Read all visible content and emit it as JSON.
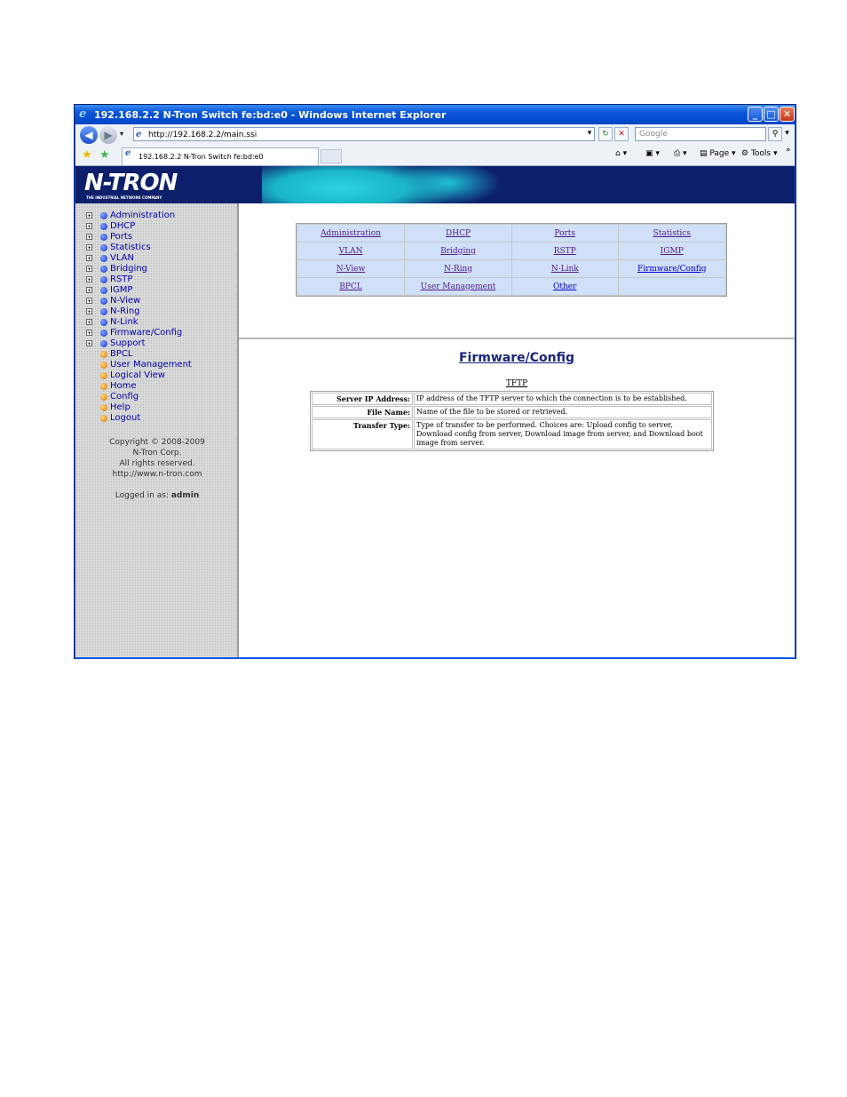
{
  "window": {
    "title": "192.168.2.2 N-Tron Switch fe:bd:e0 - Windows Internet Explorer",
    "minimize": "_",
    "maximize": "□",
    "close": "✕"
  },
  "addressbar": {
    "url": "http://192.168.2.2/main.ssi",
    "search_placeholder": "Google"
  },
  "tabs": [
    {
      "label": "192.168.2.2 N-Tron Switch fe:bd:e0"
    }
  ],
  "toolbar": {
    "page_label": "Page",
    "tools_label": "Tools"
  },
  "banner": {
    "logo": "N-TRON",
    "tagline": "THE INDUSTRIAL NETWORK COMPANY"
  },
  "sidebar": {
    "items": [
      {
        "label": "Administration",
        "expandable": true,
        "color": "blue"
      },
      {
        "label": "DHCP",
        "expandable": true,
        "color": "blue"
      },
      {
        "label": "Ports",
        "expandable": true,
        "color": "blue"
      },
      {
        "label": "Statistics",
        "expandable": true,
        "color": "blue"
      },
      {
        "label": "VLAN",
        "expandable": true,
        "color": "blue"
      },
      {
        "label": "Bridging",
        "expandable": true,
        "color": "blue"
      },
      {
        "label": "RSTP",
        "expandable": true,
        "color": "blue"
      },
      {
        "label": "IGMP",
        "expandable": true,
        "color": "blue"
      },
      {
        "label": "N-View",
        "expandable": true,
        "color": "blue"
      },
      {
        "label": "N-Ring",
        "expandable": true,
        "color": "blue"
      },
      {
        "label": "N-Link",
        "expandable": true,
        "color": "blue"
      },
      {
        "label": "Firmware/Config",
        "expandable": true,
        "color": "blue"
      },
      {
        "label": "Support",
        "expandable": true,
        "color": "blue"
      },
      {
        "label": "BPCL",
        "expandable": false,
        "color": "orange"
      },
      {
        "label": "User Management",
        "expandable": false,
        "color": "orange"
      },
      {
        "label": "Logical View",
        "expandable": false,
        "color": "orange"
      },
      {
        "label": "Home",
        "expandable": false,
        "color": "orange"
      },
      {
        "label": "Config",
        "expandable": false,
        "color": "orange"
      },
      {
        "label": "Help",
        "expandable": false,
        "color": "orange"
      },
      {
        "label": "Logout",
        "expandable": false,
        "color": "orange"
      }
    ],
    "copyright": "Copyright © 2008-2009",
    "company": "N-Tron Corp.",
    "rights": "All rights reserved.",
    "website": "http://www.n-tron.com",
    "logged_in_label": "Logged in as:",
    "logged_in_user": "admin"
  },
  "nav_grid": {
    "rows": [
      [
        "Administration",
        "DHCP",
        "Ports",
        "Statistics"
      ],
      [
        "VLAN",
        "Bridging",
        "RSTP",
        "IGMP"
      ],
      [
        "N-View",
        "N-Ring",
        "N-Link",
        "Firmware/Config"
      ],
      [
        "BPCL",
        "User Management",
        "Other",
        ""
      ]
    ]
  },
  "main": {
    "title": "Firmware/Config",
    "section": "TFTP",
    "rows": [
      {
        "key": "Server IP Address:",
        "value": "IP address of the TFTP server to which the connection is to be established."
      },
      {
        "key": "File Name:",
        "value": "Name of the file to be stored or retrieved."
      },
      {
        "key": "Transfer Type:",
        "value": "Type of transfer to be performed. Choices are: Upload config to server, Download config from server, Download image from server, and Download boot image from server."
      }
    ]
  },
  "colors": {
    "banner": "#0d1f6b",
    "nav_cell": "#cfe0f8",
    "link_visited": "#551a8b",
    "heading": "#1a237e"
  }
}
